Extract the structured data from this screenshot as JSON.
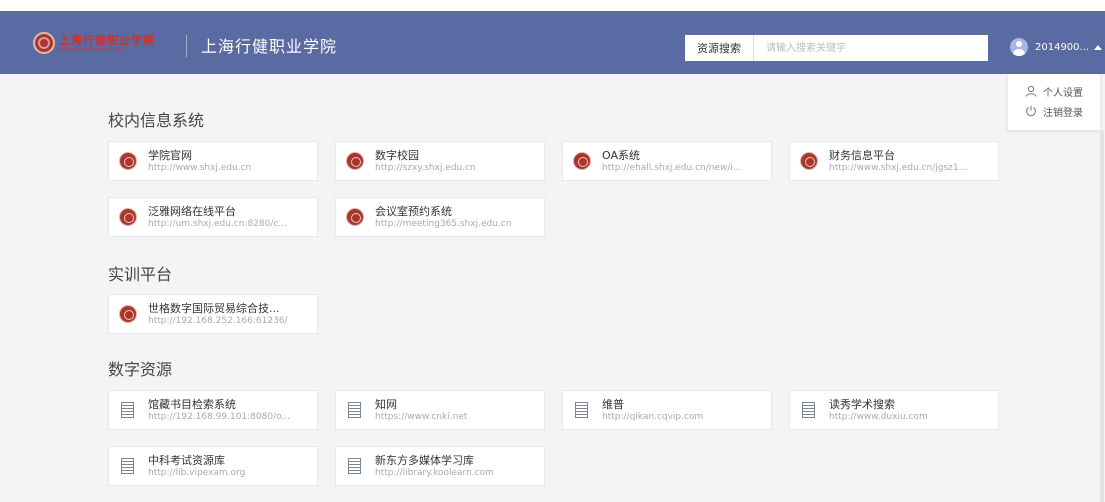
{
  "header": {
    "logo_cn": "上海行健职业学院",
    "logo_en": "SHANGHAI XINGJIAN COLLEGE",
    "site_title": "上海行健职业学院",
    "search_button": "资源搜索",
    "search_placeholder": "请输入搜索关键字",
    "user_name": "2014900...",
    "user_menu": [
      {
        "label": "个人设置",
        "icon": "user-icon"
      },
      {
        "label": "注销登录",
        "icon": "power-icon"
      }
    ]
  },
  "colors": {
    "header_bg": "#5a6aa2",
    "page_bg": "#f4f4f6",
    "logo_red": "#c8342a"
  },
  "sections": [
    {
      "title": "校内信息系统",
      "items": [
        {
          "name": "学院官网",
          "url": "http://www.shxj.edu.cn",
          "icon": "college-seal-icon"
        },
        {
          "name": "数字校园",
          "url": "http://szxy.shxj.edu.cn",
          "icon": "college-seal-icon"
        },
        {
          "name": "OA系统",
          "url": "http://ehall.shxj.edu.cn/new/i...",
          "icon": "college-seal-icon"
        },
        {
          "name": "财务信息平台",
          "url": "http://www.shxj.edu.cn/jgsz1...",
          "icon": "college-seal-icon"
        },
        {
          "name": "泛雅网络在线平台",
          "url": "http://um.shxj.edu.cn:8280/c...",
          "icon": "college-seal-icon"
        },
        {
          "name": "会议室预约系统",
          "url": "http://meeting365.shxj.edu.cn",
          "icon": "college-seal-icon"
        }
      ]
    },
    {
      "title": "实训平台",
      "items": [
        {
          "name": "世格数字国际贸易综合技...",
          "url": "http://192.168.252.166:61236/",
          "icon": "college-seal-icon"
        }
      ]
    },
    {
      "title": "数字资源",
      "items": [
        {
          "name": "馆藏书目检索系统",
          "url": "http://192.168.99.101:8080/o...",
          "icon": "document-icon"
        },
        {
          "name": "知网",
          "url": "https://www.cnki.net",
          "icon": "document-icon"
        },
        {
          "name": "维普",
          "url": "http://qikan.cqvip.com",
          "icon": "document-icon"
        },
        {
          "name": "读秀学术搜索",
          "url": "http://www.duxiu.com",
          "icon": "document-icon"
        },
        {
          "name": "中科考试资源库",
          "url": "http://lib.vipexam.org",
          "icon": "document-icon"
        },
        {
          "name": "新东方多媒体学习库",
          "url": "http://library.koolearn.com",
          "icon": "document-icon"
        }
      ]
    }
  ]
}
